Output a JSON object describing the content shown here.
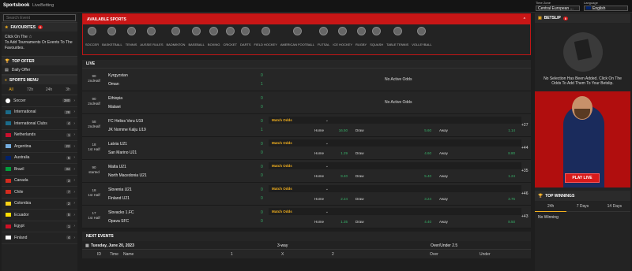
{
  "topbar": {
    "brand": "Sportsbook",
    "livebetting": "LiveBetting",
    "timezone_label": "Time Zone",
    "timezone_value": "Central European ...",
    "language_label": "Language",
    "language_value": "English"
  },
  "left": {
    "search_placeholder": "Search Event",
    "favourites_title": "FAVOURITES",
    "favourites_count": "0",
    "favourites_text": "Click On The",
    "favourites_text2": "To Add Tournaments Or Events To The Favourites.",
    "top_offer_title": "TOP OFFER",
    "daily_offer": "Daily Offer",
    "sports_menu_title": "SPORTS MENU",
    "tabs": [
      "All",
      "72h",
      "24h",
      "3h"
    ],
    "sports": [
      {
        "name": "Soccer",
        "count": "380",
        "color": "#ffffff"
      },
      {
        "name": "International",
        "count": "28",
        "color": "#1b6b8a"
      },
      {
        "name": "International Clubs",
        "count": "4",
        "color": "#1b6b8a"
      },
      {
        "name": "Netherlands",
        "count": "1",
        "color": "#c8102e"
      },
      {
        "name": "Argentina",
        "count": "22",
        "color": "#74acdf"
      },
      {
        "name": "Australia",
        "count": "5",
        "color": "#012169"
      },
      {
        "name": "Brazil",
        "count": "34",
        "color": "#009c3b"
      },
      {
        "name": "Canada",
        "count": "3",
        "color": "#d52b1e"
      },
      {
        "name": "Chile",
        "count": "7",
        "color": "#d52b1e"
      },
      {
        "name": "Colombia",
        "count": "2",
        "color": "#fcd116"
      },
      {
        "name": "Ecuador",
        "count": "5",
        "color": "#ffdd00"
      },
      {
        "name": "Egypt",
        "count": "1",
        "color": "#ce1126"
      },
      {
        "name": "Finland",
        "count": "4",
        "color": "#ffffff"
      }
    ]
  },
  "center": {
    "available_title": "AVAILABLE SPORTS",
    "sports_icons": [
      "SOCCER",
      "BASKETBALL",
      "TENNIS",
      "AUSSIE RULES",
      "BADMINTON",
      "BASEBALL",
      "BOXING",
      "CRICKET",
      "DARTS",
      "FIELD HOCKEY",
      "AMERICAN FOOTBALL",
      "FUTSAL",
      "ICE HOCKEY",
      "RUGBY",
      "SQUASH",
      "TABLE TENNIS",
      "VOLLEYBALL"
    ],
    "live_title": "LIVE",
    "matches": [
      {
        "time": "90",
        "period": "2ndHalf",
        "team1": "Kyrgyzstan",
        "team2": "Oman",
        "score1": "0",
        "score2": "1",
        "noactive": "No Active Odds"
      },
      {
        "time": "90",
        "period": "2ndHalf",
        "team1": "Ethiopia",
        "team2": "Malawi",
        "score1": "0",
        "score2": "0",
        "noactive": "No Active Odds"
      },
      {
        "time": "58",
        "period": "2ndHalf",
        "team1": "FC Helios Voru U19",
        "team2": "JK Nomme Kalju U19",
        "score1": "0",
        "score2": "1",
        "market": "Match Odds",
        "home": "16.50",
        "draw": "5.60",
        "away": "1.14",
        "more": "+27"
      },
      {
        "time": "18",
        "period": "1st Half",
        "team1": "Latvia U21",
        "team2": "San Marino U21",
        "score1": "0",
        "score2": "0",
        "market": "Match Odds",
        "home": "1.29",
        "draw": "4.60",
        "away": "8.80",
        "more": "+44"
      },
      {
        "time": "90",
        "period": "started",
        "team1": "Malta U21",
        "team2": "North Macedonia U21",
        "score1": "0",
        "score2": "0",
        "market": "Match Odds",
        "home": "9.40",
        "draw": "5.40",
        "away": "1.24",
        "more": "+35"
      },
      {
        "time": "18",
        "period": "1st Half",
        "team1": "Slovenia U21",
        "team2": "Finland U21",
        "score1": "0",
        "score2": "0",
        "market": "Match Odds",
        "home": "2.24",
        "draw": "3.24",
        "away": "3.75",
        "more": "+46"
      },
      {
        "time": "17",
        "period": "1st Half",
        "team1": "Slovacko 1.FC",
        "team2": "Opava SFC",
        "score1": "0",
        "score2": "0",
        "market": "Match Odds",
        "home": "1.35",
        "draw": "4.40",
        "away": "8.50",
        "more": "+43"
      }
    ],
    "home_label": "Home",
    "draw_label": "Draw",
    "away_label": "Away",
    "next_events_title": "NEXT EVENTS",
    "date_row": {
      "date": "Tuesday, June 20, 2023",
      "col_3way": "3-way",
      "col_ou": "Over/Under 2.5"
    },
    "header_row": {
      "id": "ID",
      "time": "Time",
      "name": "Name",
      "c1": "1",
      "cx": "X",
      "c2": "2",
      "over": "Over",
      "under": "Under"
    }
  },
  "right": {
    "betslip_title": "BETSLIP",
    "betslip_count": "0",
    "betslip_msg": "No Selection Has Been Added. Click On The Odds To Add Them To Your Betslip.",
    "play_live": "PLAY LIVE",
    "top_winnings_title": "TOP WINNINGS",
    "winning_tabs": [
      "24h",
      "7 Days",
      "14 Days"
    ],
    "no_winning": "No Winning"
  }
}
